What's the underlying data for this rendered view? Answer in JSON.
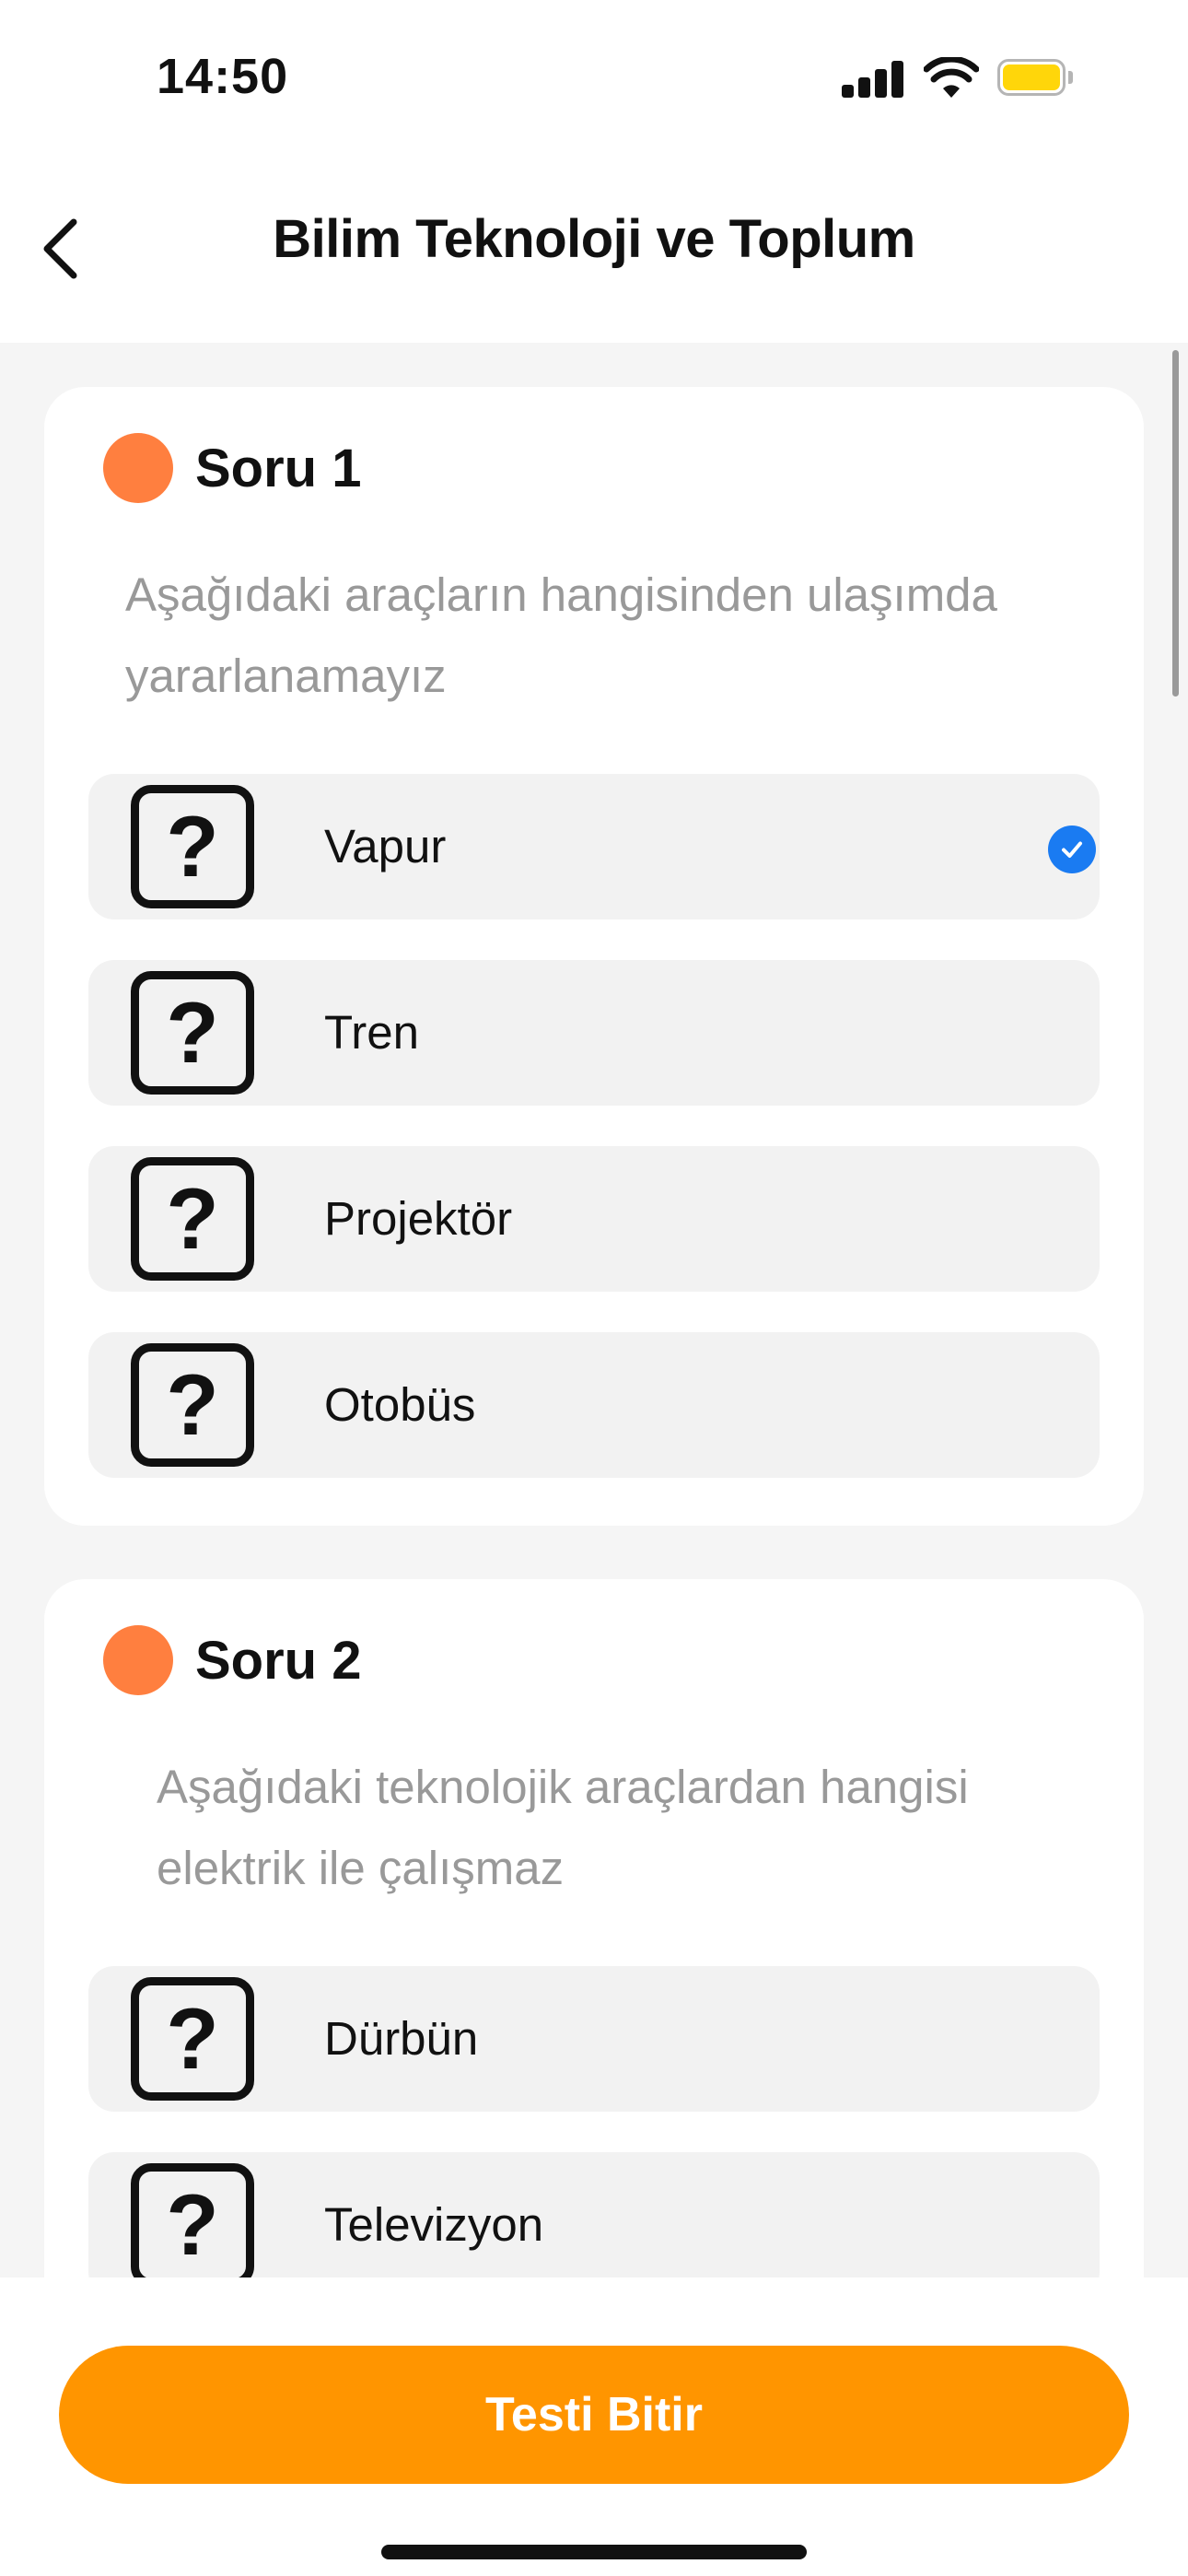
{
  "status_bar": {
    "time": "14:50",
    "icons": [
      "cellular-signal-icon",
      "wifi-icon",
      "battery-icon"
    ],
    "battery_color": "#ffd60a"
  },
  "nav": {
    "back_icon": "chevron-left-icon",
    "title": "Bilim Teknoloji ve Toplum"
  },
  "questions": [
    {
      "title": "Soru 1",
      "dot_color": "#ff7f3f",
      "text": "Aşağıdaki araçların hangisinden ulaşımda yararlanamayız",
      "options": [
        {
          "label": "Vapur",
          "icon": "question-mark-icon",
          "selected": true
        },
        {
          "label": "Tren",
          "icon": "question-mark-icon",
          "selected": false
        },
        {
          "label": "Projektör",
          "icon": "question-mark-icon",
          "selected": false
        },
        {
          "label": "Otobüs",
          "icon": "question-mark-icon",
          "selected": false
        }
      ]
    },
    {
      "title": "Soru 2",
      "dot_color": "#ff7f3f",
      "text": "Aşağıdaki teknolojik araçlardan hangisi elektrik ile çalışmaz",
      "options": [
        {
          "label": "Dürbün",
          "icon": "question-mark-icon",
          "selected": false
        },
        {
          "label": "Televizyon",
          "icon": "question-mark-icon",
          "selected": false
        }
      ]
    }
  ],
  "icon_glyph": "?",
  "selected_icon": "checkmark-circle-icon",
  "selected_color": "#1a7bf2",
  "finish_button": {
    "label": "Testi Bitir",
    "color": "#ff9500"
  }
}
